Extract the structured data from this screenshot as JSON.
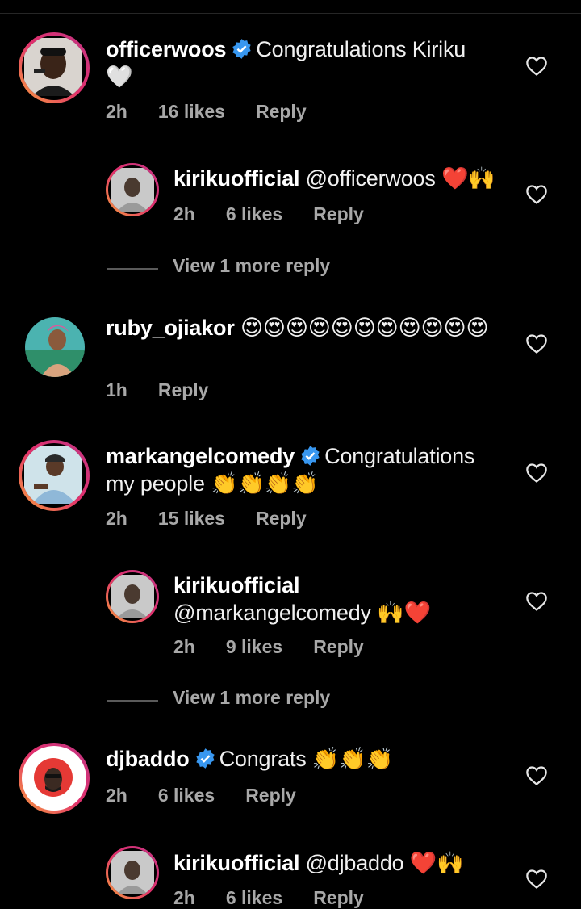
{
  "comments": [
    {
      "username": "officerwoos",
      "verified": true,
      "text": "Congratulations Kiriku",
      "emoji": "🤍",
      "time": "2h",
      "likes": "16 likes",
      "reply": "Reply"
    },
    {
      "username": "kirikuofficial",
      "verified": false,
      "text": "@officerwoos",
      "emoji": "❤️🙌",
      "time": "2h",
      "likes": "6 likes",
      "reply": "Reply"
    },
    {
      "username": "ruby_ojiakor",
      "verified": false,
      "text": "",
      "emoji": "😍😍😍😍😍😍😍😍😍😍😍",
      "time": "1h",
      "likes": "",
      "reply": "Reply"
    },
    {
      "username": "markangelcomedy",
      "verified": true,
      "text": "Congratulations my people",
      "emoji": "👏👏👏👏",
      "time": "2h",
      "likes": "15 likes",
      "reply": "Reply"
    },
    {
      "username": "kirikuofficial",
      "verified": false,
      "text": "@markangelcomedy",
      "emoji": "🙌❤️",
      "time": "2h",
      "likes": "9 likes",
      "reply": "Reply"
    },
    {
      "username": "djbaddo",
      "verified": true,
      "text": "Congrats",
      "emoji": "👏👏👏",
      "time": "2h",
      "likes": "6 likes",
      "reply": "Reply"
    },
    {
      "username": "kirikuofficial",
      "verified": false,
      "text": "@djbaddo",
      "emoji": "❤️🙌",
      "time": "2h",
      "likes": "6 likes",
      "reply": "Reply"
    }
  ],
  "view_more_label": "View 1 more reply",
  "colors": {
    "background": "#000000",
    "verified": "#3897f0",
    "muted": "#a8a8a8"
  }
}
